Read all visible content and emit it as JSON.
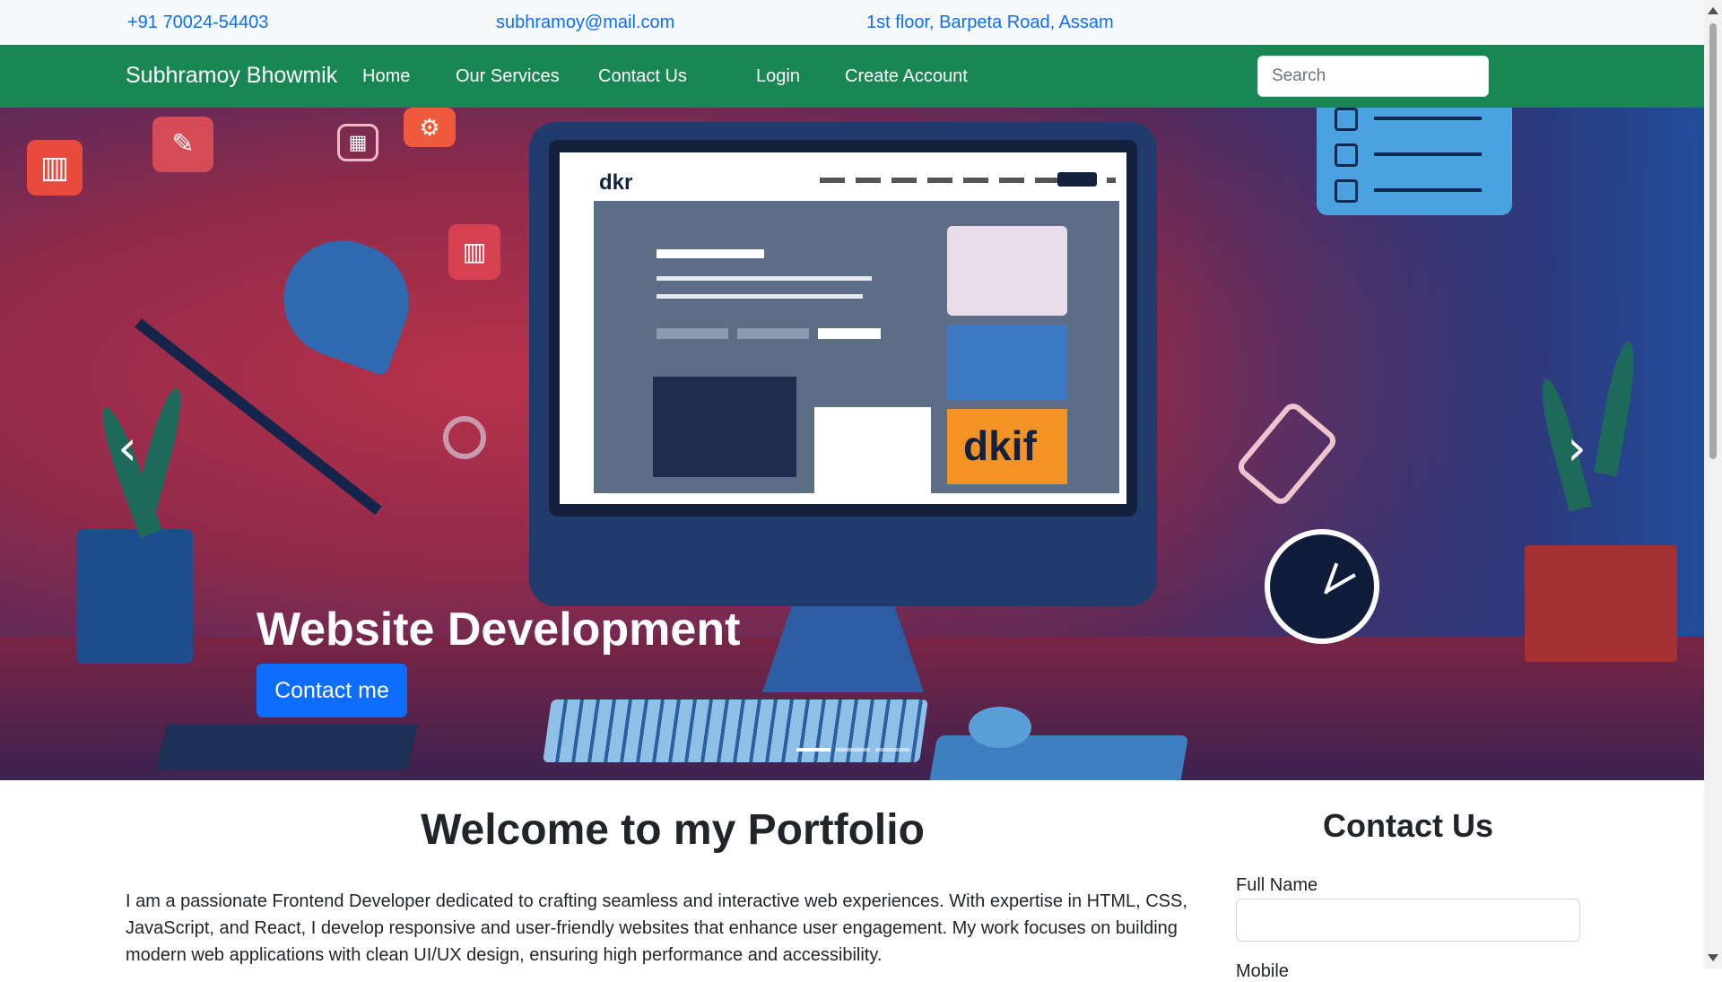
{
  "topbar": {
    "phone": "+91 70024-54403",
    "email": "subhramoy@mail.com",
    "address": "1st floor, Barpeta Road, Assam"
  },
  "navbar": {
    "brand": "Subhramoy Bhowmik",
    "links": [
      "Home",
      "Our Services",
      "Contact Us",
      "Login",
      "Create Account"
    ],
    "search_placeholder": "Search",
    "color": "#198754"
  },
  "hero": {
    "caption_title": "Website Development",
    "cta_label": "Contact me",
    "prev_icon": "chevron-left-icon",
    "next_icon": "chevron-right-icon",
    "indicators": [
      true,
      false,
      false
    ],
    "illustration": {
      "monitor_logo": "dkr",
      "tile_text": "dkif"
    }
  },
  "content": {
    "welcome_title": "Welcome to my Portfolio",
    "welcome_text": "I am a passionate Frontend Developer dedicated to crafting seamless and interactive web experiences. With expertise in HTML, CSS, JavaScript, and React, I develop responsive and user-friendly websites that enhance user engagement. My work focuses on building modern web applications with clean UI/UX design, ensuring high performance and accessibility."
  },
  "contact_form": {
    "title": "Contact Us",
    "full_name_label": "Full Name",
    "full_name_value": "",
    "next_label": "Mobile"
  },
  "colors": {
    "link": "#0d6efd",
    "navbar": "#198754",
    "button": "#0d6efd"
  }
}
